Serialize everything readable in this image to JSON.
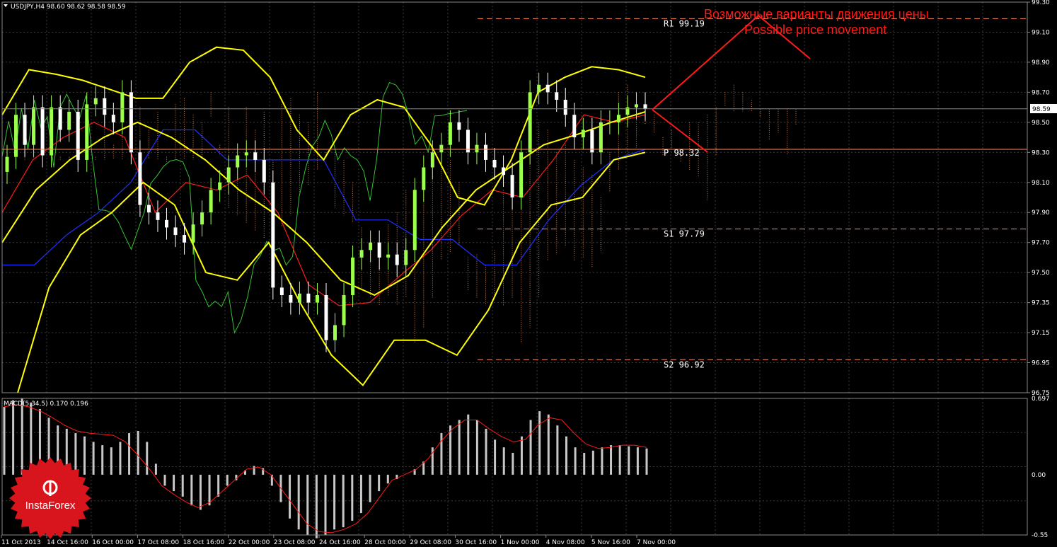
{
  "header": {
    "symbol_line": "USDJPY,H4  98.60 98.62 98.58 98.59",
    "macd_line": "MACD(5,34,5) 0.170 0.196"
  },
  "brand": {
    "name": "InstaForex",
    "color": "#d8141c"
  },
  "colors": {
    "background": "#000000",
    "grid": "#3a3a3a",
    "bull_candle": "#9cff4a",
    "bear_candle": "#ffffff",
    "bollinger": "#ffff00",
    "kijun": "#2030ff",
    "tenkan": "#ff1a1a",
    "chikou": "#36c236",
    "cloud": "#ff9a55",
    "macd_hist": "#c8c8c8",
    "macd_signal": "#ff1a1a",
    "levels": "#ff8a5a",
    "annotation": "#ff1a1a"
  },
  "chart_data": [
    {
      "type": "candlestick",
      "symbol": "USDJPY",
      "timeframe": "H4",
      "ylim": [
        96.7,
        99.3
      ],
      "y_ticks": [
        "99.30",
        "99.10",
        "98.90",
        "98.70",
        "98.50",
        "98.30",
        "98.10",
        "97.90",
        "97.70",
        "97.50",
        "97.35",
        "97.15",
        "96.95",
        "96.75"
      ],
      "x_ticks": [
        "11 Oct 2013",
        "14 Oct 16:00",
        "16 Oct 00:00",
        "17 Oct 08:00",
        "18 Oct 16:00",
        "22 Oct 00:00",
        "23 Oct 08:00",
        "24 Oct 16:00",
        "28 Oct 00:00",
        "29 Oct 08:00",
        "30 Oct 16:00",
        "1 Nov 00:00",
        "4 Nov 08:00",
        "5 Nov 16:00",
        "7 Nov 00:00"
      ],
      "current_price": "98.59",
      "closes": [
        98.27,
        98.55,
        98.35,
        98.6,
        98.28,
        98.6,
        98.45,
        98.57,
        98.25,
        98.62,
        98.66,
        98.55,
        98.5,
        98.7,
        98.3,
        97.95,
        97.9,
        97.85,
        97.8,
        97.75,
        97.7,
        97.82,
        97.9,
        98.05,
        98.1,
        98.2,
        98.28,
        98.3,
        98.25,
        98.1,
        97.4,
        97.35,
        97.3,
        97.36,
        97.3,
        97.35,
        97.05,
        97.15,
        97.35,
        97.6,
        97.65,
        97.7,
        97.6,
        97.62,
        97.55,
        97.65,
        98.05,
        98.2,
        98.3,
        98.35,
        98.5,
        98.45,
        98.3,
        98.35,
        98.25,
        98.2,
        98.15,
        98.0,
        98.3,
        98.7,
        98.75,
        98.7,
        98.65,
        98.55,
        98.4,
        98.45,
        98.3,
        98.5,
        98.5,
        98.55,
        98.6,
        98.62,
        98.59
      ],
      "levels": [
        {
          "label": "R1 99.19",
          "value": 99.19
        },
        {
          "label": "P 98.32",
          "value": 98.32
        },
        {
          "label": "S1 97.79",
          "value": 97.79
        },
        {
          "label": "S2 96.92",
          "value": 96.92
        }
      ],
      "annotations": {
        "ru": "Возможные варианты движения цены",
        "en": "Possible price movement"
      },
      "bollinger_upper": [
        98.55,
        98.85,
        98.82,
        98.78,
        98.72,
        98.66,
        98.66,
        98.9,
        99.0,
        98.98,
        98.8,
        98.45,
        98.25,
        98.55,
        98.65,
        98.6,
        98.35,
        98.0,
        97.95,
        98.25,
        98.7,
        98.8,
        98.87,
        98.85,
        98.8
      ],
      "bollinger_middle": [
        97.7,
        98.05,
        98.25,
        98.4,
        98.5,
        98.4,
        98.25,
        98.05,
        97.9,
        97.7,
        97.45,
        97.35,
        97.48,
        97.8,
        98.05,
        98.2,
        98.35,
        98.42,
        98.5,
        98.57
      ],
      "bollinger_lower": [
        96.7,
        97.4,
        97.75,
        97.9,
        98.1,
        97.95,
        97.5,
        97.45,
        97.7,
        97.3,
        96.95,
        96.75,
        97.05,
        97.05,
        96.95,
        97.25,
        97.7,
        97.95,
        98.0,
        98.25,
        98.3
      ],
      "kijun": [
        97.55,
        97.55,
        97.75,
        97.9,
        98.1,
        98.45,
        98.45,
        98.25,
        98.25,
        98.25,
        98.25,
        97.85,
        97.85,
        97.72,
        97.72,
        97.55,
        97.55,
        97.85,
        98.08,
        98.25,
        98.32
      ],
      "tenkan": [
        97.9,
        98.25,
        98.4,
        98.5,
        98.4,
        97.9,
        98.1,
        98.05,
        98.15,
        97.9,
        97.42,
        97.28,
        97.3,
        97.48,
        97.65,
        97.88,
        98.05,
        98.0,
        98.25,
        98.55,
        98.5,
        98.55
      ]
    },
    {
      "type": "bar",
      "name": "MACD(5,34,5)",
      "ylim": [
        -0.55,
        0.697
      ],
      "y_ticks": [
        "0.697",
        "0.00",
        "-0.55"
      ],
      "values": [
        0.62,
        0.68,
        0.7,
        0.66,
        0.6,
        0.52,
        0.45,
        0.42,
        0.38,
        0.35,
        0.3,
        0.27,
        0.25,
        0.3,
        0.38,
        0.4,
        0.3,
        0.1,
        -0.1,
        -0.15,
        -0.2,
        -0.28,
        -0.32,
        -0.28,
        -0.2,
        -0.1,
        -0.05,
        0.04,
        0.08,
        0.06,
        -0.1,
        -0.25,
        -0.4,
        -0.5,
        -0.55,
        -0.58,
        -0.55,
        -0.5,
        -0.48,
        -0.42,
        -0.35,
        -0.25,
        -0.15,
        -0.08,
        -0.04,
        0.0,
        0.05,
        0.12,
        0.25,
        0.38,
        0.45,
        0.5,
        0.55,
        0.5,
        0.42,
        0.32,
        0.25,
        0.2,
        0.35,
        0.5,
        0.58,
        0.55,
        0.45,
        0.35,
        0.25,
        0.2,
        0.22,
        0.25,
        0.27,
        0.27,
        0.26,
        0.25,
        0.24
      ],
      "signal": [
        0.62,
        0.64,
        0.62,
        0.58,
        0.52,
        0.45,
        0.4,
        0.38,
        0.37,
        0.36,
        0.3,
        0.18,
        0.05,
        -0.1,
        -0.18,
        -0.25,
        -0.3,
        -0.25,
        -0.15,
        -0.05,
        0.05,
        0.07,
        0.0,
        -0.15,
        -0.3,
        -0.45,
        -0.52,
        -0.53,
        -0.5,
        -0.45,
        -0.35,
        -0.2,
        -0.05,
        0.0,
        0.05,
        0.15,
        0.3,
        0.42,
        0.5,
        0.5,
        0.42,
        0.35,
        0.3,
        0.32,
        0.45,
        0.52,
        0.5,
        0.38,
        0.28,
        0.24,
        0.25,
        0.27,
        0.27,
        0.25
      ]
    }
  ]
}
